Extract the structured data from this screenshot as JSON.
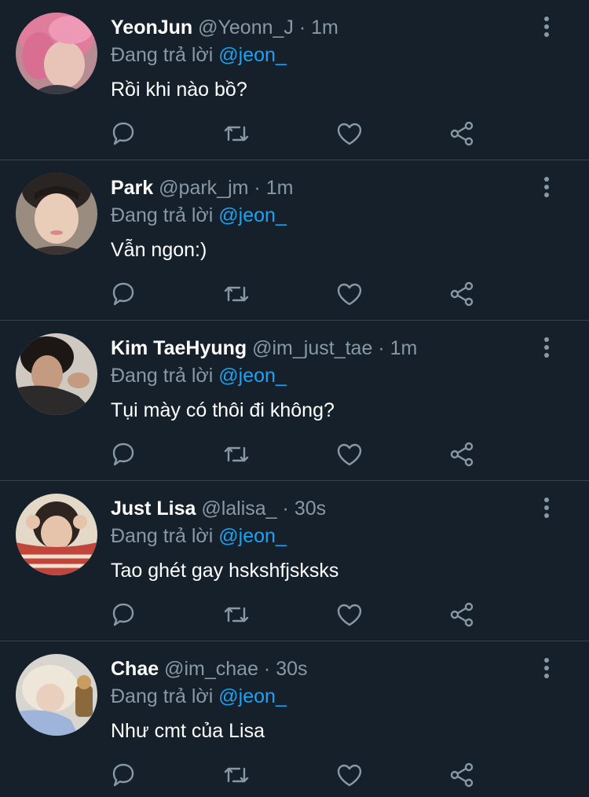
{
  "colors": {
    "background": "#15202b",
    "divider": "#38444d",
    "secondary_text": "#8899a6",
    "mention": "#1da1f2",
    "primary_text": "#ffffff"
  },
  "tweets": [
    {
      "name": "YeonJun",
      "handle": "@Yeonn_J",
      "separator": "·",
      "time": "1m",
      "reply_prefix": "Đang trả lời",
      "reply_to": "@jeon_",
      "text": "Rồi khi nào bồ?"
    },
    {
      "name": "Park",
      "handle": "@park_jm",
      "separator": "·",
      "time": "1m",
      "reply_prefix": "Đang trả lời",
      "reply_to": "@jeon_",
      "text": "Vẫn ngon:)"
    },
    {
      "name": "Kim TaeHyung",
      "handle": "@im_just_tae",
      "separator": "·",
      "time": "1m",
      "reply_prefix": "Đang trả lời",
      "reply_to": "@jeon_",
      "text": "Tụi mày có thôi đi không?"
    },
    {
      "name": "Just Lisa",
      "handle": "@lalisa_",
      "separator": "·",
      "time": "30s",
      "reply_prefix": "Đang trả lời",
      "reply_to": "@jeon_",
      "text": "Tao ghét gay hskshfjsksks"
    },
    {
      "name": "Chae",
      "handle": "@im_chae",
      "separator": "·",
      "time": "30s",
      "reply_prefix": "Đang trả lời",
      "reply_to": "@jeon_",
      "text": "Như cmt của Lisa"
    }
  ],
  "icons": {
    "reply": "reply-icon",
    "retweet": "retweet-icon",
    "like": "heart-icon",
    "share": "share-icon",
    "more": "more-vertical-icon"
  }
}
